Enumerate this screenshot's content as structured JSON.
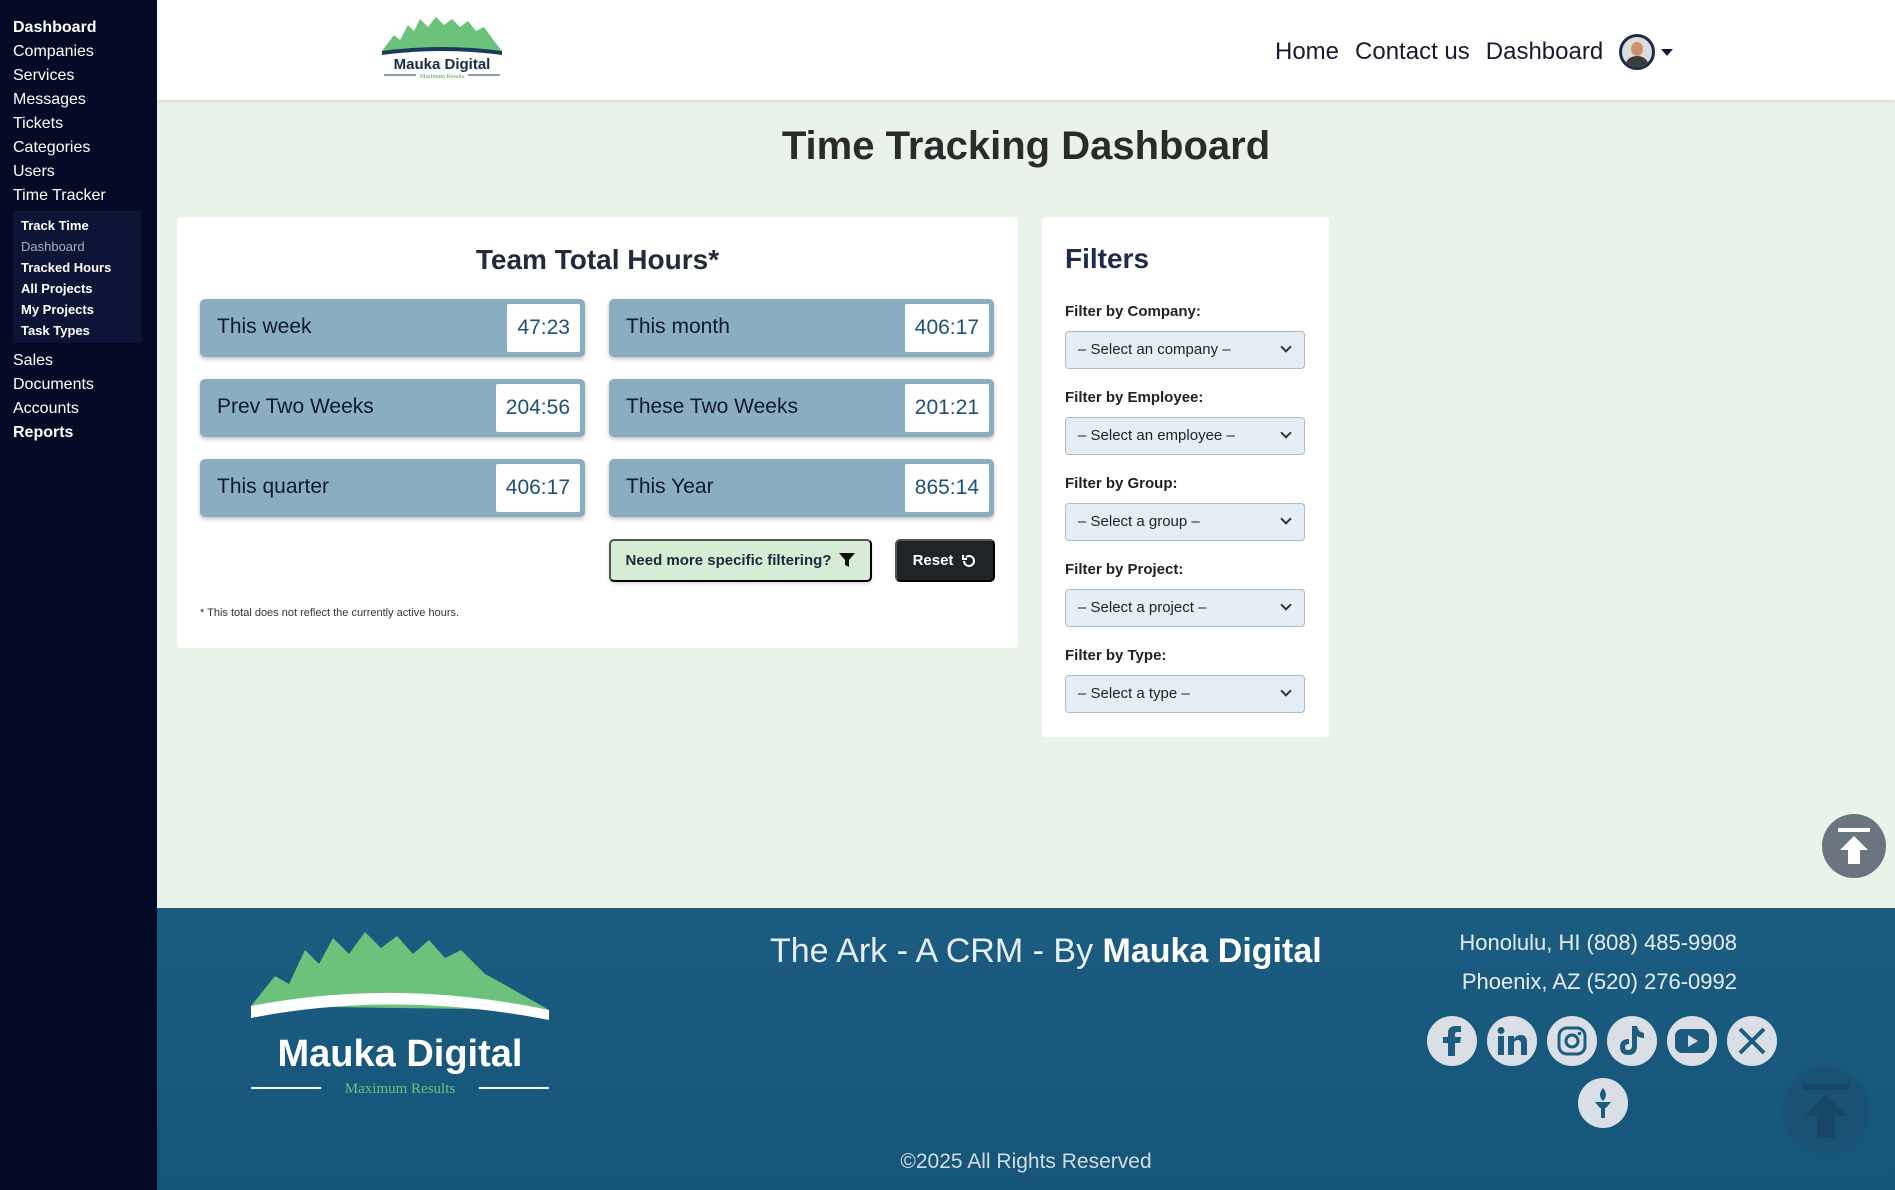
{
  "sidebar": {
    "items_top": [
      {
        "label": "Dashboard",
        "bold": true
      },
      {
        "label": "Companies"
      },
      {
        "label": "Services"
      },
      {
        "label": "Messages"
      },
      {
        "label": "Tickets"
      },
      {
        "label": "Categories"
      },
      {
        "label": "Users"
      },
      {
        "label": "Time Tracker"
      }
    ],
    "submenu": [
      {
        "label": "Track Time"
      },
      {
        "label": "Dashboard",
        "active": true
      },
      {
        "label": "Tracked Hours"
      },
      {
        "label": "All Projects"
      },
      {
        "label": "My Projects"
      },
      {
        "label": "Task Types"
      }
    ],
    "items_bottom": [
      {
        "label": "Sales"
      },
      {
        "label": "Documents"
      },
      {
        "label": "Accounts"
      },
      {
        "label": "Reports",
        "bold": true
      }
    ]
  },
  "header": {
    "logo_text": "Mauka Digital",
    "logo_tagline": "Maximum Results",
    "nav": {
      "home": "Home",
      "contact": "Contact us",
      "dashboard": "Dashboard"
    }
  },
  "page": {
    "title": "Time Tracking Dashboard"
  },
  "hours": {
    "title": "Team Total Hours*",
    "stats": [
      {
        "label": "This week",
        "value": "47:23"
      },
      {
        "label": "This month",
        "value": "406:17"
      },
      {
        "label": "Prev Two Weeks",
        "value": "204:56"
      },
      {
        "label": "These Two Weeks",
        "value": "201:21"
      },
      {
        "label": "This quarter",
        "value": "406:17"
      },
      {
        "label": "This Year",
        "value": "865:14"
      }
    ],
    "filter_button": "Need more specific filtering?",
    "reset_button": "Reset",
    "note": "* This total does not reflect the currently active hours."
  },
  "filters": {
    "title": "Filters",
    "company": {
      "label": "Filter by Company:",
      "value": "– Select an company –"
    },
    "employee": {
      "label": "Filter by Employee:",
      "value": "– Select an employee –"
    },
    "group": {
      "label": "Filter by Group:",
      "value": "– Select a group –"
    },
    "project": {
      "label": "Filter by Project:",
      "value": "– Select a project –"
    },
    "type": {
      "label": "Filter by Type:",
      "value": "– Select a type –"
    }
  },
  "footer": {
    "title_prefix": "The Ark - A CRM - By ",
    "title_brand": "Mauka Digital",
    "phone_hi": "Honolulu, HI (808) 485-9908",
    "phone_az": "Phoenix, AZ (520) 276-0992",
    "social_icons": [
      "facebook-icon",
      "linkedin-icon",
      "instagram-icon",
      "tiktok-icon",
      "youtube-icon",
      "x-icon"
    ],
    "copyright": "©2025 All Rights Reserved",
    "logo_text": "Mauka Digital",
    "logo_tagline": "Maximum Results"
  },
  "colors": {
    "sidebar_bg": "#050a26",
    "page_bg": "#eaf3ea",
    "stat_bg": "#8badc2",
    "footer_bg": "#1b5c80",
    "logo_green": "#6cc17b"
  }
}
